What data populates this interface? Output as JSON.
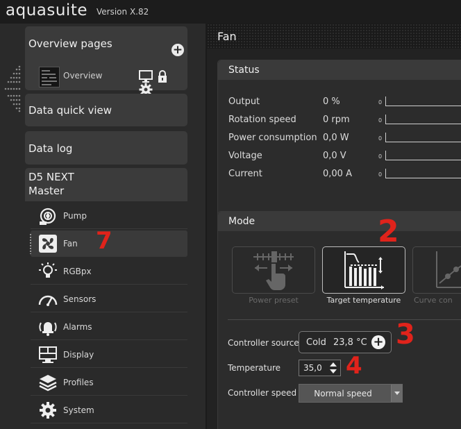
{
  "app": {
    "title": "aquasuite",
    "version": "Version X.82"
  },
  "sidebar": {
    "overview_pages": {
      "label": "Overview pages",
      "add_icon": "plus-circle-icon"
    },
    "overview_item": {
      "label": "Overview",
      "icons": [
        "monitor-icon",
        "lock-icon",
        "gear-icon"
      ]
    },
    "quick_view": {
      "label": "Data quick view"
    },
    "data_log": {
      "label": "Data log"
    },
    "device": {
      "line1": "D5 NEXT",
      "line2": "Master"
    },
    "items": [
      {
        "label": "Pump",
        "icon": "pump-icon"
      },
      {
        "label": "Fan",
        "icon": "fan-icon",
        "active": true
      },
      {
        "label": "RGBpx",
        "icon": "lightbulb-icon"
      },
      {
        "label": "Sensors",
        "icon": "gauge-icon"
      },
      {
        "label": "Alarms",
        "icon": "alarm-bell-icon"
      },
      {
        "label": "Display",
        "icon": "display-icon"
      },
      {
        "label": "Profiles",
        "icon": "layers-icon"
      },
      {
        "label": "System",
        "icon": "gear-icon"
      }
    ]
  },
  "main": {
    "title": "Fan",
    "status": {
      "title": "Status",
      "rows": [
        {
          "label": "Output",
          "value": "0 %",
          "bar_zero": "0"
        },
        {
          "label": "Rotation speed",
          "value": "0 rpm",
          "bar_zero": "0"
        },
        {
          "label": "Power consumption",
          "value": "0,0 W",
          "bar_zero": "0"
        },
        {
          "label": "Voltage",
          "value": "0,0 V",
          "bar_zero": "0"
        },
        {
          "label": "Current",
          "value": "0,00 A",
          "bar_zero": "0"
        }
      ]
    },
    "mode": {
      "title": "Mode",
      "options": [
        {
          "label": "Power preset",
          "icon": "slider-hand-icon",
          "selected": false
        },
        {
          "label": "Target temperature",
          "icon": "target-temperature-icon",
          "selected": true
        },
        {
          "label": "Curve con",
          "icon": "curve-chart-icon",
          "selected": false
        }
      ],
      "controller_source": {
        "label": "Controller source",
        "name": "Cold",
        "value": "23,8 °C"
      },
      "temperature": {
        "label": "Temperature",
        "value": "35,0"
      },
      "controller_speed": {
        "label": "Controller speed",
        "value": "Normal speed"
      }
    }
  },
  "annotations": [
    "7",
    "2",
    "3",
    "4"
  ],
  "colors": {
    "accent_red": "#e0231b",
    "panel": "#2c2c2c",
    "panel_header": "#3a3a3a"
  }
}
